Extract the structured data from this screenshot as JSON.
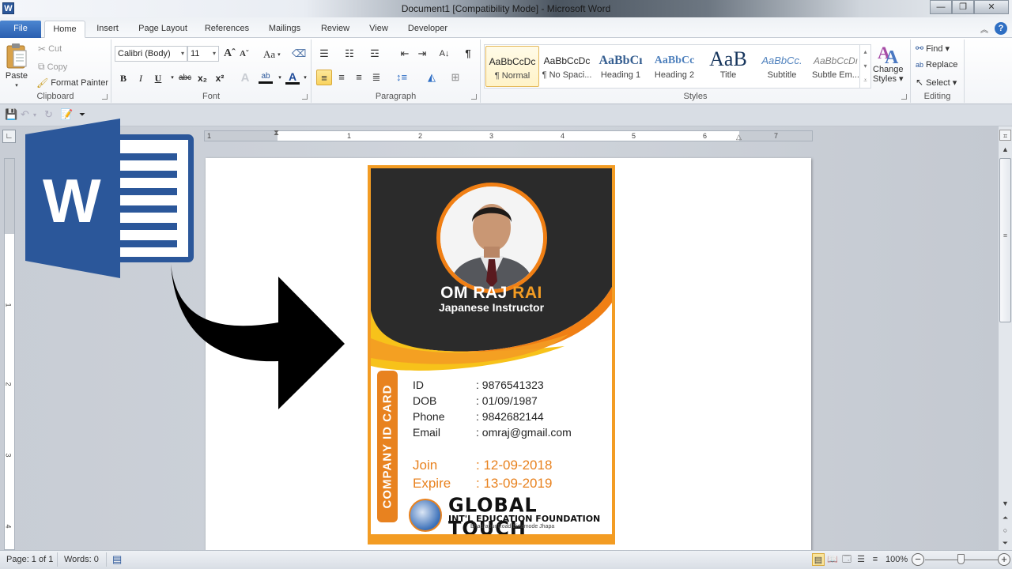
{
  "window": {
    "app_icon": "W",
    "title": "Document1 [Compatibility Mode]  -  Microsoft Word",
    "controls": {
      "minimize": "—",
      "restore": "❐",
      "close": "✕"
    }
  },
  "tabs": [
    {
      "label": "File"
    },
    {
      "label": "Home",
      "active": true
    },
    {
      "label": "Insert"
    },
    {
      "label": "Page Layout"
    },
    {
      "label": "References"
    },
    {
      "label": "Mailings"
    },
    {
      "label": "Review"
    },
    {
      "label": "View"
    },
    {
      "label": "Developer"
    }
  ],
  "ribbon": {
    "clipboard": {
      "label": "Clipboard",
      "paste": "Paste",
      "cut": "Cut",
      "copy": "Copy",
      "format_painter": "Format Painter"
    },
    "font": {
      "label": "Font",
      "font_name": "Calibri (Body)",
      "font_size": "11",
      "grow": "Aˆ",
      "shrink": "Aˇ",
      "change_case": "Aa",
      "bold": "B",
      "italic": "I",
      "underline": "U",
      "strikethrough": "abc",
      "subscript": "x₂",
      "superscript": "x²",
      "text_effects": "A",
      "highlight": "ab",
      "font_color": "A"
    },
    "paragraph": {
      "label": "Paragraph"
    },
    "styles": {
      "label": "Styles",
      "items": [
        {
          "sample": "AaBbCcDc",
          "name": "¶ Normal",
          "selected": true
        },
        {
          "sample": "AaBbCcDc",
          "name": "¶ No Spaci..."
        },
        {
          "sample": "AaBbCı",
          "name": "Heading 1"
        },
        {
          "sample": "AaBbCc",
          "name": "Heading 2"
        },
        {
          "sample": "AaB",
          "name": "Title"
        },
        {
          "sample": "AaBbCc.",
          "name": "Subtitle"
        },
        {
          "sample": "AaBbCcDı",
          "name": "Subtle Em..."
        }
      ],
      "change_styles_line1": "Change",
      "change_styles_line2": "Styles ▾"
    },
    "editing": {
      "label": "Editing",
      "find": "Find ▾",
      "replace": "Replace",
      "select": "Select ▾"
    }
  },
  "ruler": {
    "horizontal_numbers": [
      "1",
      "1",
      "2",
      "3",
      "4",
      "5",
      "6",
      "7"
    ],
    "vertical_numbers": [
      "1",
      "2",
      "3",
      "4"
    ]
  },
  "id_card": {
    "first_name": "OM RAJ ",
    "last_name": "RAI",
    "role": "Japanese Instructor",
    "badge_text": "COMPANY ID CARD",
    "fields": [
      {
        "key": "ID",
        "value": ": 9876541323"
      },
      {
        "key": "DOB",
        "value": ": 01/09/1987"
      },
      {
        "key": "Phone",
        "value": ": 9842682144"
      },
      {
        "key": "Email",
        "value": ": omraj@gmail.com"
      }
    ],
    "dates": [
      {
        "key": "Join",
        "value": ": 12-09-2018"
      },
      {
        "key": "Expire",
        "value": ": 13-09-2019"
      }
    ],
    "org_name": "GLOBAL TOUCH",
    "org_subtitle": "INT'L EDUCATION FOUNDATION",
    "org_address": "Bhadrapur Road Birtamode Jhapa",
    "colors": {
      "orange": "#f39c23",
      "dark": "#2b2b2b",
      "yellow": "#f7c21a"
    }
  },
  "statusbar": {
    "page": "Page: 1 of 1",
    "words": "Words: 0",
    "zoom": "100%",
    "zoom_percent": 100
  }
}
